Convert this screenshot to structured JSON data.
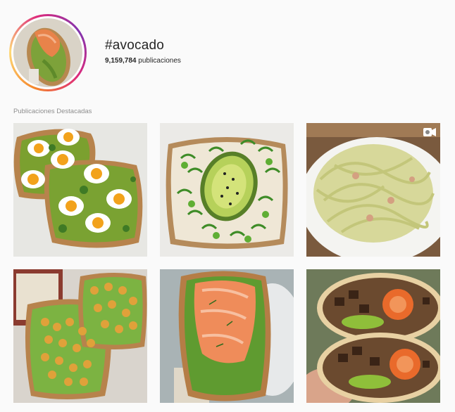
{
  "hashtag": {
    "title": "#avocado",
    "post_count": "9,159,784",
    "post_label": "publicaciones"
  },
  "section": {
    "title": "Publicaciones Destacadas"
  },
  "posts": [
    {
      "icon": "egg-avocado-toast-image"
    },
    {
      "icon": "avocado-microgreens-toast-image"
    },
    {
      "icon": "avocado-pasta-image",
      "badge": "video-icon"
    },
    {
      "icon": "chickpea-avocado-toast-image"
    },
    {
      "icon": "salmon-avocado-toast-image"
    },
    {
      "icon": "shrimp-burrito-image"
    }
  ],
  "colors": {
    "story_ring_from": "#f58529",
    "story_ring_to": "#dd2a7b",
    "background": "#fafafa",
    "muted_text": "#8e8e8e"
  }
}
